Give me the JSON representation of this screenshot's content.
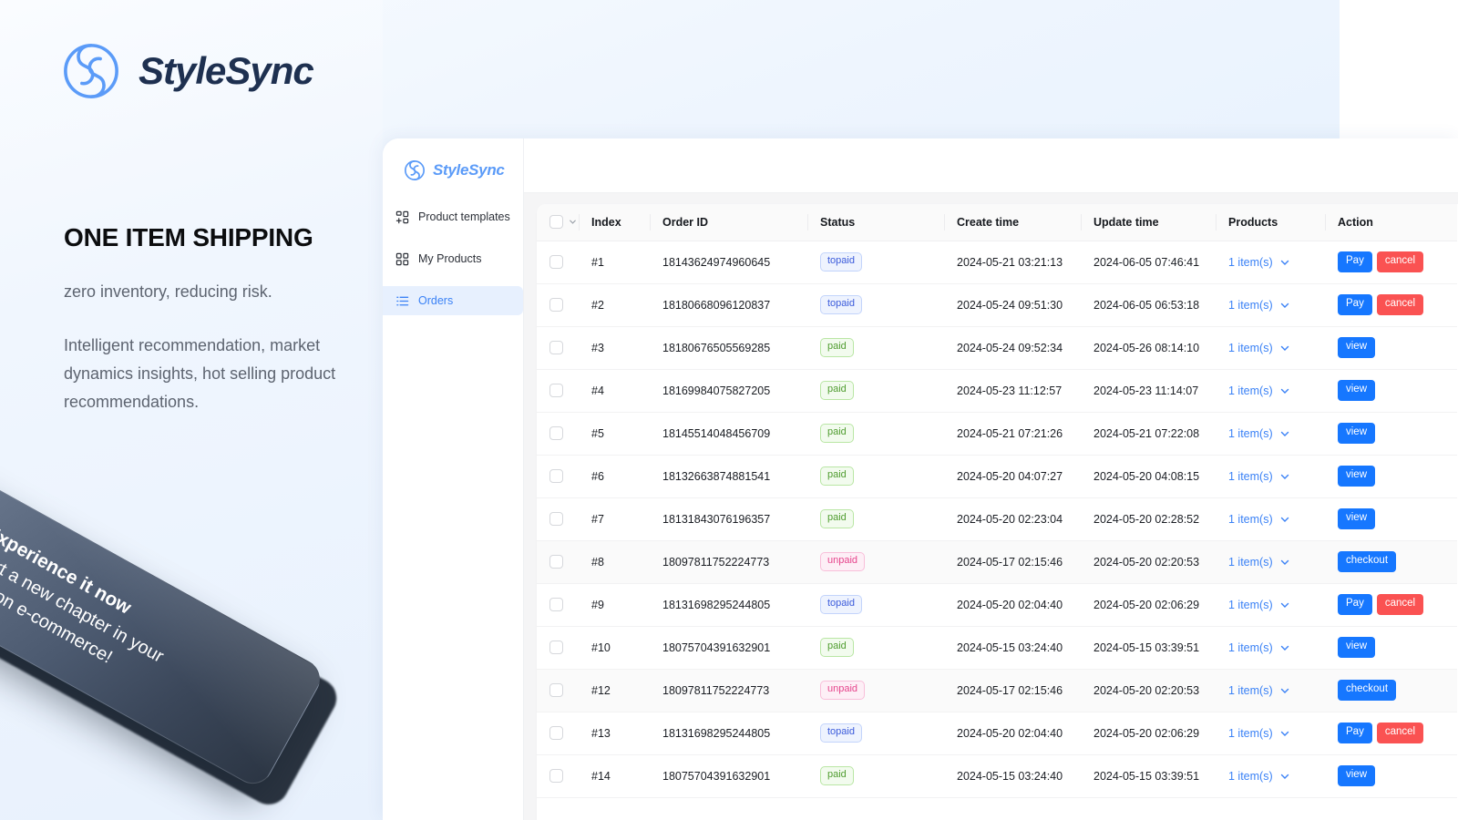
{
  "brand": {
    "name": "StyleSync",
    "logo_icon": "stylesync-swirl-logo"
  },
  "marketing": {
    "headline": "ONE ITEM SHIPPING",
    "sub1": "zero inventory, reducing risk.",
    "sub2": "Intelligent recommendation, market dynamics insights, hot selling product recommendations."
  },
  "hang_tag": {
    "line1": "Experience it now",
    "line2": "start a new chapter in your",
    "line3": "fashion e-commerce!"
  },
  "sidebar": {
    "brand_name": "StyleSync",
    "items": [
      {
        "label": "Product templates",
        "icon": "template-grid-icon",
        "active": false
      },
      {
        "label": "My Products",
        "icon": "products-grid-icon",
        "active": false
      },
      {
        "label": "Orders",
        "icon": "list-icon",
        "active": true
      }
    ]
  },
  "table": {
    "columns": [
      "Index",
      "Order ID",
      "Status",
      "Create time",
      "Update time",
      "Products",
      "Action"
    ],
    "select_all_icon": "checkbox-icon",
    "select_all_chevron_icon": "chevron-down-icon",
    "rows": [
      {
        "index": "#1",
        "order_id": "18143624974960645",
        "status": "topaid",
        "create_time": "2024-05-21 03:21:13",
        "update_time": "2024-06-05 07:46:41",
        "products": "1 item(s)",
        "actions": [
          "Pay",
          "cancel"
        ]
      },
      {
        "index": "#2",
        "order_id": "18180668096120837",
        "status": "topaid",
        "create_time": "2024-05-24 09:51:30",
        "update_time": "2024-06-05 06:53:18",
        "products": "1 item(s)",
        "actions": [
          "Pay",
          "cancel"
        ]
      },
      {
        "index": "#3",
        "order_id": "18180676505569285",
        "status": "paid",
        "create_time": "2024-05-24 09:52:34",
        "update_time": "2024-05-26 08:14:10",
        "products": "1 item(s)",
        "actions": [
          "view"
        ]
      },
      {
        "index": "#4",
        "order_id": "18169984075827205",
        "status": "paid",
        "create_time": "2024-05-23 11:12:57",
        "update_time": "2024-05-23 11:14:07",
        "products": "1 item(s)",
        "actions": [
          "view"
        ]
      },
      {
        "index": "#5",
        "order_id": "18145514048456709",
        "status": "paid",
        "create_time": "2024-05-21 07:21:26",
        "update_time": "2024-05-21 07:22:08",
        "products": "1 item(s)",
        "actions": [
          "view"
        ]
      },
      {
        "index": "#6",
        "order_id": "18132663874881541",
        "status": "paid",
        "create_time": "2024-05-20 04:07:27",
        "update_time": "2024-05-20 04:08:15",
        "products": "1 item(s)",
        "actions": [
          "view"
        ]
      },
      {
        "index": "#7",
        "order_id": "18131843076196357",
        "status": "paid",
        "create_time": "2024-05-20 02:23:04",
        "update_time": "2024-05-20 02:28:52",
        "products": "1 item(s)",
        "actions": [
          "view"
        ]
      },
      {
        "index": "#8",
        "order_id": "18097811752224773",
        "status": "unpaid",
        "create_time": "2024-05-17 02:15:46",
        "update_time": "2024-05-20 02:20:53",
        "products": "1 item(s)",
        "actions": [
          "checkout"
        ]
      },
      {
        "index": "#9",
        "order_id": "18131698295244805",
        "status": "topaid",
        "create_time": "2024-05-20 02:04:40",
        "update_time": "2024-05-20 02:06:29",
        "products": "1 item(s)",
        "actions": [
          "Pay",
          "cancel"
        ]
      },
      {
        "index": "#10",
        "order_id": "18075704391632901",
        "status": "paid",
        "create_time": "2024-05-15 03:24:40",
        "update_time": "2024-05-15 03:39:51",
        "products": "1 item(s)",
        "actions": [
          "view"
        ]
      },
      {
        "index": "#12",
        "order_id": "18097811752224773",
        "status": "unpaid",
        "create_time": "2024-05-17 02:15:46",
        "update_time": "2024-05-20 02:20:53",
        "products": "1 item(s)",
        "actions": [
          "checkout"
        ]
      },
      {
        "index": "#13",
        "order_id": "18131698295244805",
        "status": "topaid",
        "create_time": "2024-05-20 02:04:40",
        "update_time": "2024-05-20 02:06:29",
        "products": "1 item(s)",
        "actions": [
          "Pay",
          "cancel"
        ]
      },
      {
        "index": "#14",
        "order_id": "18075704391632901",
        "status": "paid",
        "create_time": "2024-05-15 03:24:40",
        "update_time": "2024-05-15 03:39:51",
        "products": "1 item(s)",
        "actions": [
          "view"
        ]
      }
    ]
  },
  "colors": {
    "brand_blue": "#5b9bf8",
    "action_blue": "#1677ff",
    "cancel_red": "#fa5252",
    "status_topaid": "#3b5bdb",
    "status_paid": "#4f9c2f",
    "status_unpaid": "#e6458c",
    "page_bg": "#e8f1fd"
  }
}
